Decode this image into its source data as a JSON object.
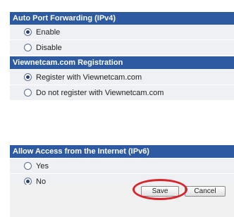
{
  "sections": {
    "auto_port": {
      "title": "Auto Port Forwarding (IPv4)",
      "options": [
        {
          "label": "Enable",
          "checked": true
        },
        {
          "label": "Disable",
          "checked": false
        }
      ]
    },
    "viewnetcam": {
      "title": "Viewnetcam.com Registration",
      "options": [
        {
          "label": "Register with Viewnetcam.com",
          "checked": true
        },
        {
          "label": "Do not register with Viewnetcam.com",
          "checked": false
        }
      ]
    },
    "internet_access": {
      "title": "Allow Access from the Internet (IPv6)",
      "options": [
        {
          "label": "Yes",
          "checked": false
        },
        {
          "label": "No",
          "checked": true
        }
      ]
    }
  },
  "buttons": {
    "save": "Save",
    "cancel": "Cancel"
  },
  "colors": {
    "header_bg": "#2d5aa0",
    "row_bg": "#eef0f4",
    "highlight": "#d9232a"
  }
}
